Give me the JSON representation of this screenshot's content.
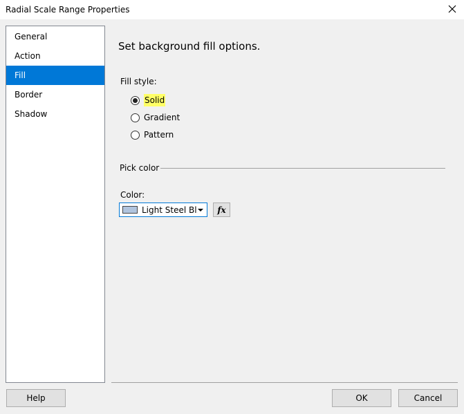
{
  "window": {
    "title": "Radial Scale Range Properties"
  },
  "nav": {
    "items": [
      {
        "label": "General"
      },
      {
        "label": "Action"
      },
      {
        "label": "Fill"
      },
      {
        "label": "Border"
      },
      {
        "label": "Shadow"
      }
    ],
    "selected": "Fill"
  },
  "main": {
    "heading": "Set background fill options.",
    "fill_style": {
      "label": "Fill style:",
      "options": [
        {
          "label": "Solid",
          "checked": true
        },
        {
          "label": "Gradient",
          "checked": false
        },
        {
          "label": "Pattern",
          "checked": false
        }
      ]
    },
    "pick_color": {
      "title": "Pick color",
      "color_label": "Color:",
      "color_value": "Light Steel Bl...",
      "swatch_color": "#b0c4de",
      "fx_label": "fx"
    }
  },
  "footer": {
    "help_label": "Help",
    "ok_label": "OK",
    "cancel_label": "Cancel"
  },
  "colors": {
    "accent": "#0078d7",
    "highlight": "#ffff66"
  }
}
